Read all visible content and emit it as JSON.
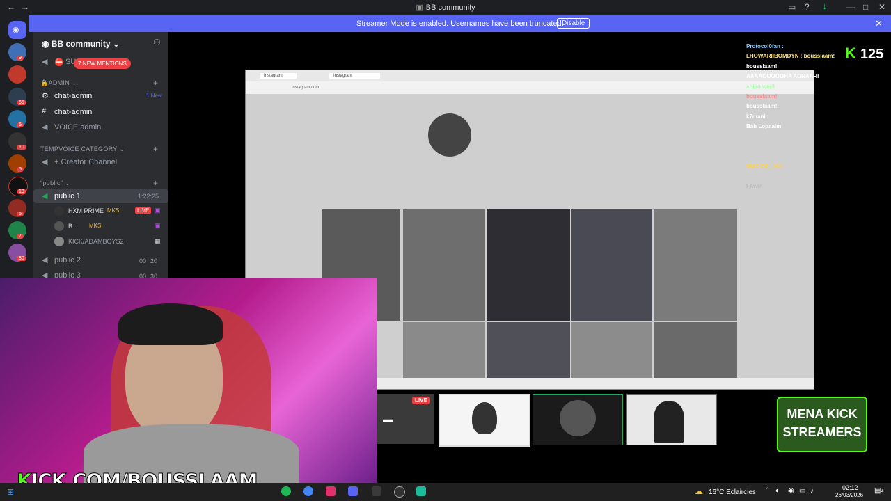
{
  "window": {
    "title": "BB community"
  },
  "banner": {
    "message": "Streamer Mode is enabled. Usernames have been truncated.",
    "button": "Disable"
  },
  "server": {
    "name": "BB community"
  },
  "mentions": "7 NEW MENTIONS",
  "channels": {
    "su_prefix": "SU",
    "admin_category": "ADMIN",
    "chat_admin_1": "chat-admin",
    "new_badge": "1 New",
    "chat_admin_2": "chat-admin",
    "voice_admin": "VOICE admin",
    "tempvoice_category": "TEMPVOICE CATEGORY",
    "creator_channel": "Creator Channel",
    "public_category": "\"public\"",
    "public1": "public 1",
    "public1_time": "1:22:25",
    "users": [
      {
        "name": "HXM PRIME",
        "tag": "MKS",
        "live": "LIVE"
      },
      {
        "name": "B...",
        "tag": "MKS"
      },
      {
        "name": "KICK/ADAMBOYS2"
      }
    ],
    "public2": "public 2",
    "public2_time_a": "00",
    "public2_time_b": "20",
    "public3": "public 3",
    "public3_time_a": "00",
    "public3_time_b": "30"
  },
  "server_badges": [
    "9",
    "55",
    "5",
    "10",
    "5",
    "18",
    "5",
    "7",
    "80",
    "5"
  ],
  "viewers": "125",
  "chat": [
    {
      "text": "Protocol0fan :",
      "color": "#7ec8ff"
    },
    {
      "text": "LHOWARIIBOMDYN : bousslaam!",
      "color": "#ffe27a"
    },
    {
      "text": "bousslaam!",
      "color": "#ffffff"
    },
    {
      "text": "AAAAOOOOOHA ADRAARI",
      "color": "#ffffff"
    },
    {
      "text": "ahlan we/d",
      "color": "#a4ffa4"
    },
    {
      "text": "bousslaam!",
      "color": "#ff8c8c"
    },
    {
      "text": "bousslaam!",
      "color": "#ffffff"
    },
    {
      "text": "k7mani :",
      "color": "#ffffff"
    },
    {
      "text": "Bab Lopaalm",
      "color": "#ffffff"
    },
    {
      "text": "",
      "color": "#7ec8ff"
    },
    {
      "text": "",
      "color": "#ffd24a"
    },
    {
      "text": "",
      "color": "#7ec8ff"
    },
    {
      "text": "WARIOR_10K :",
      "color": "#ffd24a"
    },
    {
      "text": "",
      "color": "#ff5c5c"
    },
    {
      "text": "FAvar",
      "color": "#bbbbbb"
    }
  ],
  "share": {
    "tab1": "Instagram",
    "tab2": "Instagram",
    "url": "instagram.com"
  },
  "stream": {
    "live_label": "LIVE",
    "kick_url_prefix": "K",
    "kick_url_rest": "ICK.COM/BOUSSLAAM",
    "mena_line1": "MENA KICK",
    "mena_line2": "STREAMERS"
  },
  "taskbar": {
    "weather": "16°C  Eclaircies",
    "time": "02:12",
    "date": "26/03/2026",
    "notif": "4"
  }
}
